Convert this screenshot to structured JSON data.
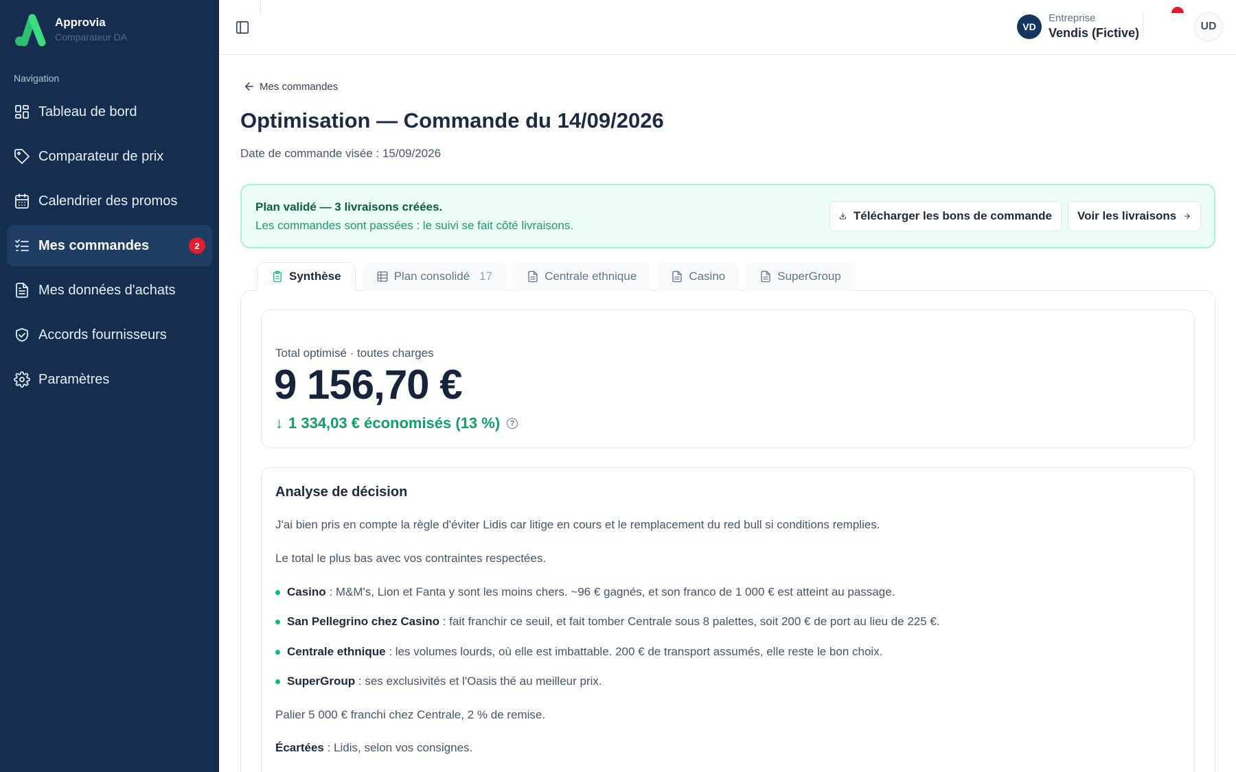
{
  "brand": {
    "name": "Approvia",
    "subtitle": "Comparateur DA"
  },
  "nav": {
    "heading": "Navigation",
    "items": [
      {
        "label": "Tableau de bord",
        "icon": "dashboard-icon"
      },
      {
        "label": "Comparateur de prix",
        "icon": "tag-icon"
      },
      {
        "label": "Calendrier des promos",
        "icon": "calendar-icon"
      },
      {
        "label": "Mes commandes",
        "icon": "list-check-icon",
        "active": true,
        "badge": "2"
      },
      {
        "label": "Mes données d'achats",
        "icon": "file-icon"
      },
      {
        "label": "Accords fournisseurs",
        "icon": "handshake-icon"
      },
      {
        "label": "Paramètres",
        "icon": "gear-icon"
      }
    ]
  },
  "topbar": {
    "company_label": "Entreprise",
    "company_name": "Vendis (Fictive)",
    "company_logo": "VD",
    "avatar": "UD"
  },
  "page": {
    "back_label": "Mes commandes",
    "title": "Optimisation — Commande du 14/09/2026",
    "subtitle": "Date de commande visée : 15/09/2026"
  },
  "alert": {
    "title": "Plan validé — 3 livraisons créées.",
    "text": "Les commandes sont passées : le suivi se fait côté livraisons.",
    "download_label": "Télécharger les bons de commande",
    "deliveries_label": "Voir les livraisons"
  },
  "tabs": [
    {
      "label": "Synthèse",
      "active": true
    },
    {
      "label": "Plan consolidé",
      "count": "17"
    },
    {
      "label": "Centrale ethnique"
    },
    {
      "label": "Casino"
    },
    {
      "label": "SuperGroup"
    }
  ],
  "summary": {
    "total_label": "Total optimisé · toutes charges",
    "total_value": "9 156,70 €",
    "savings_arrow": "↓",
    "savings": "1 334,03 € économisés (13 %)",
    "help": "?"
  },
  "analysis": {
    "title": "Analyse de décision",
    "intro": "J'ai bien pris en compte la règle d'éviter Lidis car litige en cours et le remplacement du red bull si conditions remplies.",
    "p2": "Le total le plus bas avec vos contraintes respectées.",
    "bullets": [
      {
        "bold": "Casino",
        "text": " : M&M's, Lion et Fanta y sont les moins chers. ~96 € gagnés, et son franco de 1 000 € est atteint au passage."
      },
      {
        "bold": "San Pellegrino chez Casino",
        "text": " : fait franchir ce seuil, et fait tomber Centrale sous 8 palettes, soit 200 € de port au lieu de 225 €."
      },
      {
        "bold": "Centrale ethnique",
        "text": " : les volumes lourds, où elle est imbattable. 200 € de transport assumés, elle reste le bon choix."
      },
      {
        "bold": "SuperGroup",
        "text": " : ses exclusivités et l'Oasis thé au meilleur prix."
      }
    ],
    "p3": "Palier 5 000 € franchi chez Centrale, 2 % de remise.",
    "excluded_bold": "Écartées",
    "excluded_text": " : Lidis, selon vos consignes."
  },
  "colors": {
    "sidebar": "#152e4f",
    "accent_green": "#10b981",
    "badge_red": "#e11d2e"
  }
}
